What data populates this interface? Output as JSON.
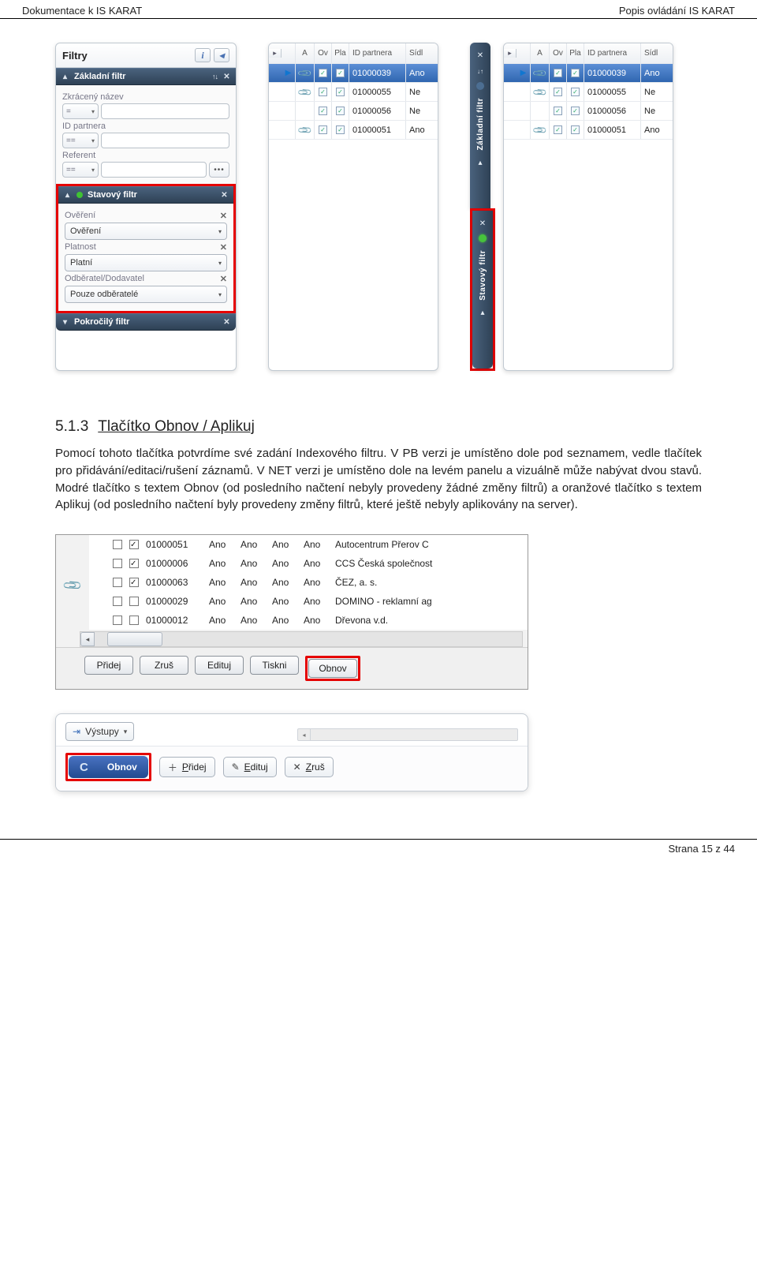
{
  "header": {
    "left": "Dokumentace k IS KARAT",
    "right": "Popis ovládání IS KARAT"
  },
  "filter_panel": {
    "title": "Filtry",
    "sections": {
      "basic": {
        "title": "Základní filtr",
        "field1_label": "Zkrácený název",
        "field1_op": "=",
        "field2_label": "ID partnera",
        "field2_op": "==",
        "field3_label": "Referent",
        "field3_op": "=="
      },
      "status": {
        "title": "Stavový filtr",
        "f1_label": "Ověření",
        "f1_value": "Ověření",
        "f2_label": "Platnost",
        "f2_value": "Platní",
        "f3_label": "Odběratel/Dodavatel",
        "f3_value": "Pouze odběratelé"
      },
      "advanced": {
        "title": "Pokročilý filtr"
      }
    }
  },
  "grid": {
    "cols": {
      "a": "A",
      "ov": "Ov",
      "pla": "Pla",
      "id": "ID partnera",
      "sidl": "Sídl"
    },
    "rows": [
      {
        "clip": true,
        "c1": true,
        "c2": true,
        "id": "01000039",
        "sidl": "Ano"
      },
      {
        "clip": true,
        "c1": true,
        "c2": true,
        "id": "01000055",
        "sidl": "Ne"
      },
      {
        "clip": false,
        "c1": true,
        "c2": true,
        "id": "01000056",
        "sidl": "Ne"
      },
      {
        "clip": true,
        "c1": true,
        "c2": true,
        "id": "01000051",
        "sidl": "Ano"
      }
    ]
  },
  "vbar": {
    "t1": "Základní filtr",
    "t2": "Stavový filtr"
  },
  "section": {
    "num": "5.1.3",
    "title": "Tlačítko Obnov / Aplikuj",
    "body": "Pomocí tohoto tlačítka potvrdíme své zadání Indexového filtru. V PB verzi je umístěno dole pod seznamem, vedle tlačítek pro přidávání/editaci/rušení záznamů. V NET verzi je umístěno dole na levém panelu a vizuálně může nabývat dvou stavů. Modré tlačítko s textem Obnov (od posledního načtení nebyly provedeny žádné změny filtrů) a oranžové tlačítko s textem Aplikuj (od posledního načtení byly provedeny změny filtrů, které ještě nebyly aplikovány na server)."
  },
  "pb_grid": {
    "rows": [
      {
        "c1": false,
        "c2": true,
        "id": "01000051",
        "a": "Ano",
        "name": "Autocentrum Přerov C"
      },
      {
        "c1": false,
        "c2": true,
        "id": "01000006",
        "a": "Ano",
        "name": "CCS Česká společnost"
      },
      {
        "c1": false,
        "c2": true,
        "id": "01000063",
        "a": "Ano",
        "name": "ČEZ, a. s."
      },
      {
        "c1": false,
        "c2": false,
        "id": "01000029",
        "a": "Ano",
        "name": "DOMINO - reklamní ag"
      },
      {
        "c1": false,
        "c2": false,
        "id": "01000012",
        "a": "Ano",
        "name": "Dřevona v.d."
      }
    ],
    "buttons": {
      "add": "Přidej",
      "cancel": "Zruš",
      "edit": "Edituj",
      "print": "Tiskni",
      "refresh": "Obnov"
    }
  },
  "net_bar": {
    "vystupy": "Výstupy",
    "obnov": "Obnov",
    "add": "Přidej",
    "edit": "Edituj",
    "cancel": "Zruš"
  },
  "footer": "Strana 15 z 44"
}
